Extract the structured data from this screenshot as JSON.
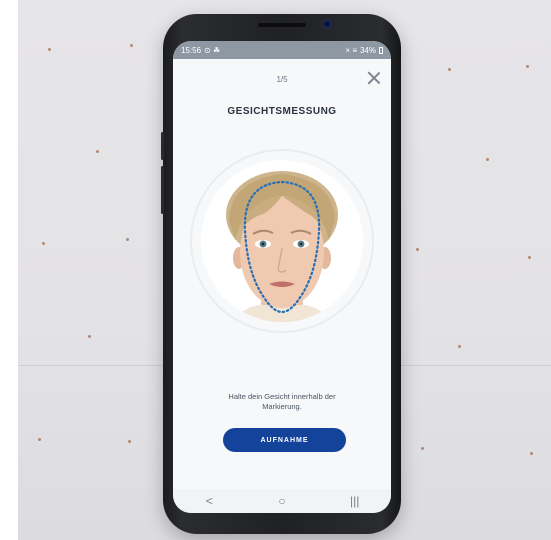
{
  "status_bar": {
    "time": "15:56",
    "left_icons": "⊙ ☘",
    "right_icons": "× ≡",
    "battery": "34%"
  },
  "header": {
    "step": "1/5",
    "title": "GESICHTSMESSUNG"
  },
  "instructions": {
    "line1": "Halte dein Gesicht innerhalb der",
    "line2": "Markierung."
  },
  "capture_button": {
    "label": "AUFNAHME"
  },
  "nav": {
    "back_glyph": "<",
    "home_glyph": "○",
    "recents_glyph": "|||"
  },
  "colors": {
    "accent": "#13439a",
    "face_guide": "#2a6fb5"
  }
}
